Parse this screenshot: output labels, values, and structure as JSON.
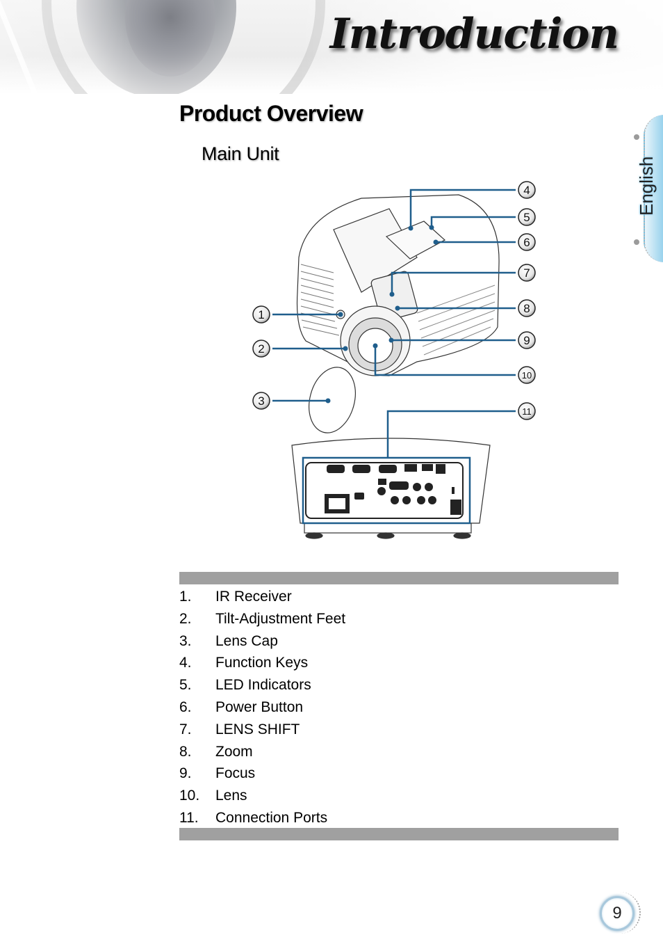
{
  "header": {
    "chapter_title": "Introduction"
  },
  "language_tab": {
    "label": "English",
    "accent_color": "#6bbfe3"
  },
  "section": {
    "title": "Product Overview",
    "subtitle": "Main Unit"
  },
  "figure": {
    "description": "Projector main unit diagram with numbered callouts",
    "callout_color": "#1f5e8c",
    "callouts": [
      "1",
      "2",
      "3",
      "4",
      "5",
      "6",
      "7",
      "8",
      "9",
      "10",
      "11"
    ]
  },
  "parts_list": [
    {
      "number": "1.",
      "label": "IR Receiver"
    },
    {
      "number": "2.",
      "label": "Tilt-Adjustment Feet"
    },
    {
      "number": "3.",
      "label": "Lens Cap"
    },
    {
      "number": "4.",
      "label": "Function Keys"
    },
    {
      "number": "5.",
      "label": "LED Indicators"
    },
    {
      "number": "6.",
      "label": "Power Button"
    },
    {
      "number": "7.",
      "label": "LENS SHIFT"
    },
    {
      "number": "8.",
      "label": "Zoom"
    },
    {
      "number": "9.",
      "label": "Focus"
    },
    {
      "number": "10.",
      "label": "Lens"
    },
    {
      "number": "11.",
      "label": "Connection Ports"
    }
  ],
  "footer": {
    "page_number": "9"
  }
}
